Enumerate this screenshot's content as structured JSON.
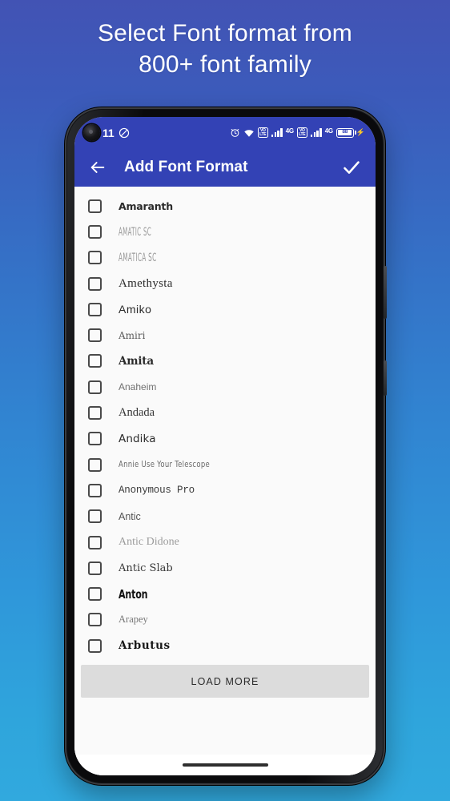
{
  "promo": {
    "line1": "Select Font format from",
    "line2": "800+ font family",
    "text_color": "#FFFFFF"
  },
  "background": {
    "gradient_top": "#4253B4",
    "gradient_bottom": "#31A9DE"
  },
  "phone": {
    "frame_color": "#111214",
    "screen_bg": "#FAFAFA"
  },
  "status_bar": {
    "background": "#3342B5",
    "time": "11",
    "left_icons": [
      {
        "name": "punch-hole-camera"
      },
      {
        "name": "dnd-mute-icon"
      }
    ],
    "right_icons": [
      {
        "name": "alarm-clock-icon"
      },
      {
        "name": "wifi-icon"
      },
      {
        "name": "volte-icon",
        "label": "VoLTE"
      },
      {
        "name": "signal-bars-icon-1"
      },
      {
        "name": "network-type-4g-1",
        "label": "4G"
      },
      {
        "name": "volte-icon-2",
        "label": "VoLTE"
      },
      {
        "name": "signal-bars-icon-2"
      },
      {
        "name": "network-type-4g-2",
        "label": "4G"
      },
      {
        "name": "battery-icon",
        "label": "88"
      }
    ],
    "battery_level": "88",
    "battery_charging": true
  },
  "app_bar": {
    "background": "#3342B5",
    "title": "Add Font Format",
    "back_icon": "arrow-left-icon",
    "confirm_icon": "check-icon"
  },
  "font_list": {
    "items": [
      {
        "name": "Amaranth",
        "style": "f-amaranth",
        "checked": false
      },
      {
        "name": "AMATIC SC",
        "style": "f-amatic",
        "checked": false
      },
      {
        "name": "AMATICA SC",
        "style": "f-amatica",
        "checked": false
      },
      {
        "name": "Amethysta",
        "style": "f-amethysta",
        "checked": false
      },
      {
        "name": "Amiko",
        "style": "f-amiko",
        "checked": false
      },
      {
        "name": "Amiri",
        "style": "f-amiri",
        "checked": false
      },
      {
        "name": "Amita",
        "style": "f-amita",
        "checked": false
      },
      {
        "name": "Anaheim",
        "style": "f-anaheim",
        "checked": false
      },
      {
        "name": "Andada",
        "style": "f-andada",
        "checked": false
      },
      {
        "name": "Andika",
        "style": "f-andika",
        "checked": false
      },
      {
        "name": "Annie Use Your Telescope",
        "style": "f-annie",
        "checked": false
      },
      {
        "name": "Anonymous Pro",
        "style": "f-anonymous",
        "checked": false
      },
      {
        "name": "Antic",
        "style": "f-antic",
        "checked": false
      },
      {
        "name": "Antic Didone",
        "style": "f-anticdidone",
        "checked": false
      },
      {
        "name": "Antic Slab",
        "style": "f-anticslab",
        "checked": false
      },
      {
        "name": "Anton",
        "style": "f-anton",
        "checked": false
      },
      {
        "name": "Arapey",
        "style": "f-arapey",
        "checked": false
      },
      {
        "name": "Arbutus",
        "style": "f-arbutus",
        "checked": false
      }
    ]
  },
  "load_more": {
    "label": "LOAD MORE",
    "background": "#DCDCDC"
  },
  "navigation": {
    "gesture_bar": "home-indicator"
  }
}
